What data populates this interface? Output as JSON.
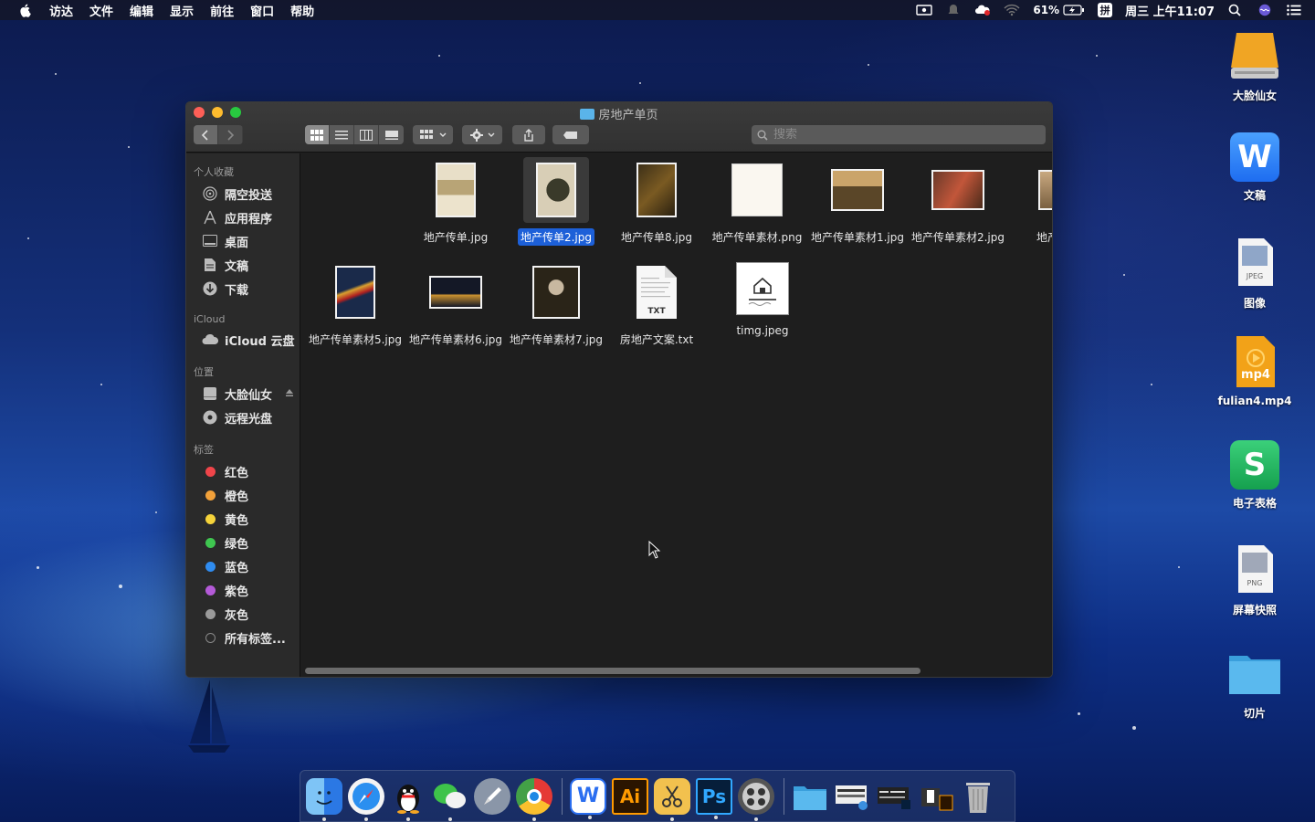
{
  "menubar": {
    "items": [
      "访达",
      "文件",
      "编辑",
      "显示",
      "前往",
      "窗口",
      "帮助"
    ],
    "battery": "61%",
    "clock": "周三 上午11:07",
    "input_method": "拼"
  },
  "desktop": {
    "icons": [
      {
        "label": "大脸仙女",
        "icon": "drive-icon"
      },
      {
        "label": "文稿",
        "icon": "wps-writer-icon",
        "badge": "W"
      },
      {
        "label": "图像",
        "icon": "jpeg-file-icon",
        "badge": "JPEG"
      },
      {
        "label": "fulian4.mp4",
        "icon": "mp4-file-icon",
        "badge": "mp4"
      },
      {
        "label": "电子表格",
        "icon": "wps-spreadsheet-icon",
        "badge": "S"
      },
      {
        "label": "屏幕快照",
        "icon": "png-file-icon",
        "badge": "PNG"
      },
      {
        "label": "切片",
        "icon": "folder-icon"
      }
    ]
  },
  "finder": {
    "title": "房地产单页",
    "search_placeholder": "搜索",
    "sidebar": {
      "favorites_header": "个人收藏",
      "favorites": [
        "隔空投送",
        "应用程序",
        "桌面",
        "文稿",
        "下载"
      ],
      "icloud_header": "iCloud",
      "icloud": [
        "iCloud 云盘"
      ],
      "locations_header": "位置",
      "locations": [
        "大脸仙女",
        "远程光盘"
      ],
      "tags_header": "标签",
      "tags": [
        {
          "label": "红色",
          "color": "#f0454a"
        },
        {
          "label": "橙色",
          "color": "#f2a13a"
        },
        {
          "label": "黄色",
          "color": "#f5d33a"
        },
        {
          "label": "绿色",
          "color": "#3fc650"
        },
        {
          "label": "蓝色",
          "color": "#2f8cf0"
        },
        {
          "label": "紫色",
          "color": "#b45ad8"
        },
        {
          "label": "灰色",
          "color": "#9a9a9a"
        },
        {
          "label": "所有标签...",
          "color": ""
        }
      ]
    },
    "files_row1": [
      "地产传单.jpg",
      "地产传单2.jpg",
      "地产传单8.jpg",
      "地产传单素材.png",
      "地产传单素材1.jpg",
      "地产传单素材2.jpg",
      "地产传单"
    ],
    "files_row2": [
      "地产传单素材5.jpg",
      "地产传单素材6.jpg",
      "地产传单素材7.jpg",
      "房地产文案.txt",
      "timg.jpeg"
    ],
    "selected_file": "地产传单2.jpg",
    "txt_badge": "TXT"
  },
  "dock": {
    "apps": [
      "finder-icon",
      "safari-icon",
      "qq-icon",
      "wechat-icon",
      "launchpad-icon",
      "chrome-icon",
      "wps-icon",
      "illustrator-icon",
      "scissors-app-icon",
      "photoshop-icon",
      "photo-booth-icon",
      "downloads-folder-icon",
      "screenshot-stack-icon",
      "screenshot-stack-2-icon",
      "stack-ai-icon",
      "trash-icon"
    ],
    "labels": {
      "wps": "W",
      "ai": "Ai",
      "ps": "Ps"
    }
  },
  "colors": {
    "accent": "#1d60d8",
    "window_bg": "#1e1e1e",
    "sidebar_bg": "#2a2a2a"
  }
}
